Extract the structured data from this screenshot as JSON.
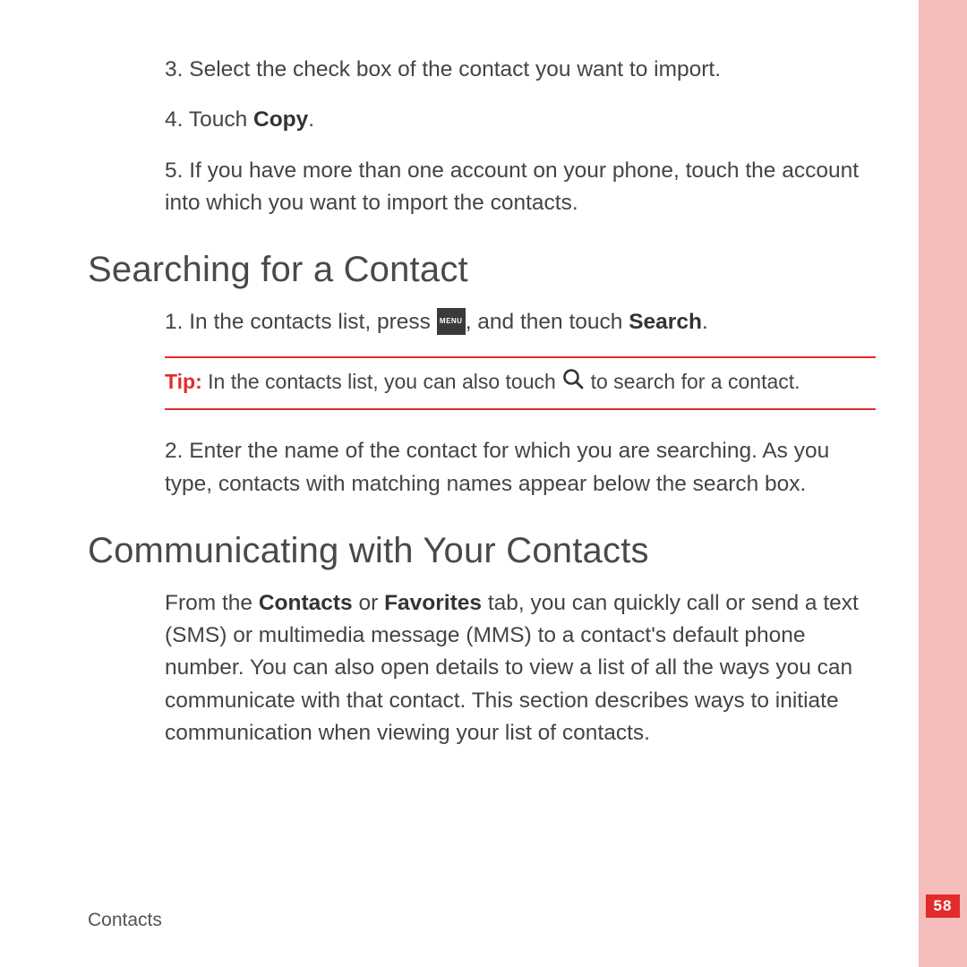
{
  "steps_top": {
    "s3": {
      "num": "3.",
      "text": "Select the check box of the contact you want to import."
    },
    "s4": {
      "num": "4.",
      "pre": "Touch ",
      "bold": "Copy",
      "post": "."
    },
    "s5": {
      "num": "5.",
      "text": "If you have more than one account on your phone, touch the account into which you want to import the contacts."
    }
  },
  "heading1": "Searching for a Contact",
  "search_steps": {
    "s1": {
      "num": "1.",
      "pre": "In the contacts list, press ",
      "post": ", and then touch ",
      "bold": "Search",
      "end": "."
    },
    "s2": {
      "num": "2.",
      "text": "Enter the name of the contact for which you are searching. As you type, contacts with matching names appear below the search box."
    }
  },
  "menu_label": "MENU",
  "tip": {
    "label": "Tip:",
    "pre": "  In the contacts list, you can also touch ",
    "post": " to search for a contact."
  },
  "heading2": "Communicating with Your Contacts",
  "comm_para": {
    "pre": "From the ",
    "b1": "Contacts",
    "mid1": " or ",
    "b2": "Favorites",
    "post": " tab, you can quickly call or send a text (SMS) or multimedia message (MMS) to a contact's default phone number. You can also open details to view a list of all the ways you can communicate with that contact. This section describes ways to initiate communication when viewing your list of contacts."
  },
  "footer": "Contacts",
  "page_number": "58"
}
